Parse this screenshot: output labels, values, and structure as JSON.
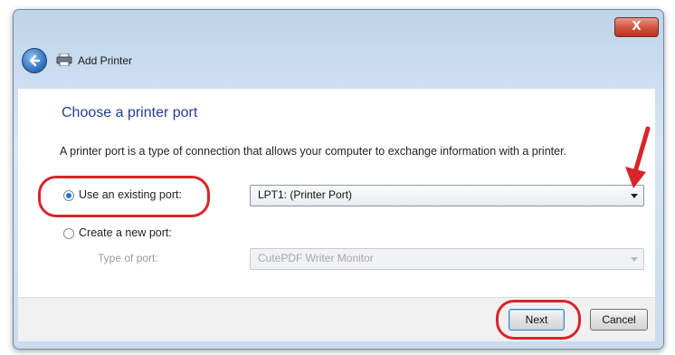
{
  "window": {
    "title": "Add Printer",
    "close_label": "X"
  },
  "page": {
    "heading": "Choose a printer port",
    "description": "A printer port is a type of connection that allows your computer to exchange information with a printer."
  },
  "options": {
    "existing_port_label": "Use an existing port:",
    "existing_port_selected": true,
    "existing_port_value": "LPT1: (Printer Port)",
    "new_port_label": "Create a new port:",
    "new_port_selected": false,
    "port_type_label": "Type of port:",
    "port_type_value": "CutePDF Writer Monitor"
  },
  "buttons": {
    "next": "Next",
    "cancel": "Cancel"
  },
  "colors": {
    "annotation": "#d6262a",
    "heading": "#1f3f8f"
  }
}
